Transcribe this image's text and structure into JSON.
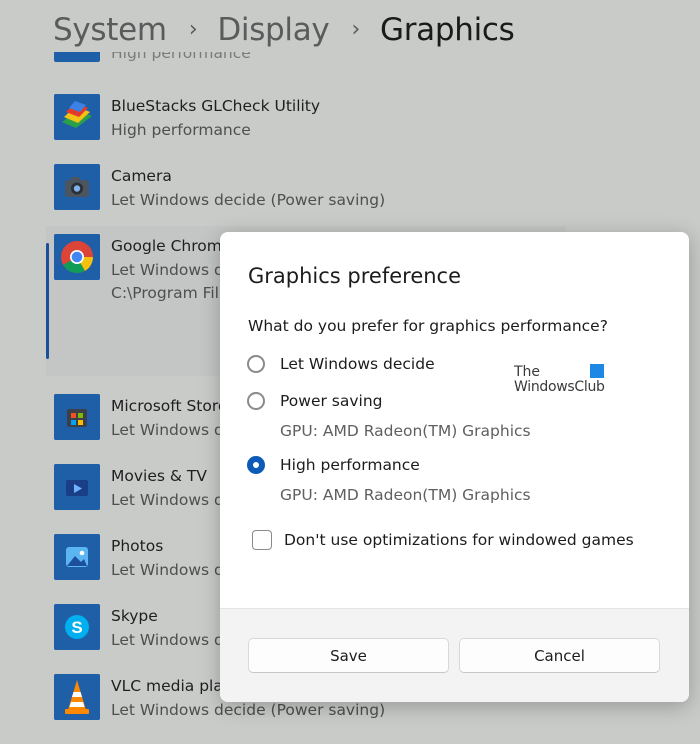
{
  "breadcrumb": {
    "items": [
      "System",
      "Display",
      "Graphics"
    ],
    "separator": "›"
  },
  "app_list": {
    "partial_top": {
      "pref": "High performance"
    },
    "apps": [
      {
        "name": "BlueStacks GLCheck Utility",
        "pref": "High performance",
        "icon": "bluestacks-icon"
      },
      {
        "name": "Camera",
        "pref": "Let Windows decide (Power saving)",
        "icon": "camera-icon"
      },
      {
        "name": "Google Chrome",
        "pref": "Let Windows decide",
        "path": "C:\\Program Files",
        "icon": "chrome-icon"
      },
      {
        "name": "Microsoft Store",
        "pref": "Let Windows decide",
        "icon": "store-icon"
      },
      {
        "name": "Movies & TV",
        "pref": "Let Windows decide",
        "icon": "movies-tv-icon"
      },
      {
        "name": "Photos",
        "pref": "Let Windows decide",
        "icon": "photos-icon"
      },
      {
        "name": "Skype",
        "pref": "Let Windows decide",
        "icon": "skype-icon"
      },
      {
        "name": "VLC media player",
        "pref": "Let Windows decide (Power saving)",
        "icon": "vlc-icon"
      }
    ]
  },
  "dialog": {
    "title": "Graphics preference",
    "question": "What do you prefer for graphics performance?",
    "options": [
      {
        "label": "Let Windows decide",
        "checked": false
      },
      {
        "label": "Power saving",
        "note": "GPU: AMD Radeon(TM) Graphics",
        "checked": false
      },
      {
        "label": "High performance",
        "note": "GPU: AMD Radeon(TM) Graphics",
        "checked": true
      }
    ],
    "checkbox_label": "Don't use optimizations for windowed games",
    "checkbox_checked": false,
    "save_label": "Save",
    "cancel_label": "Cancel"
  },
  "watermark": {
    "line1": "The",
    "line2": "WindowsClub"
  },
  "colors": {
    "accent": "#0c5bb8",
    "background": "#c9cbc9",
    "dialog_bg": "#ffffff",
    "footer_bg": "#f3f3f3"
  }
}
